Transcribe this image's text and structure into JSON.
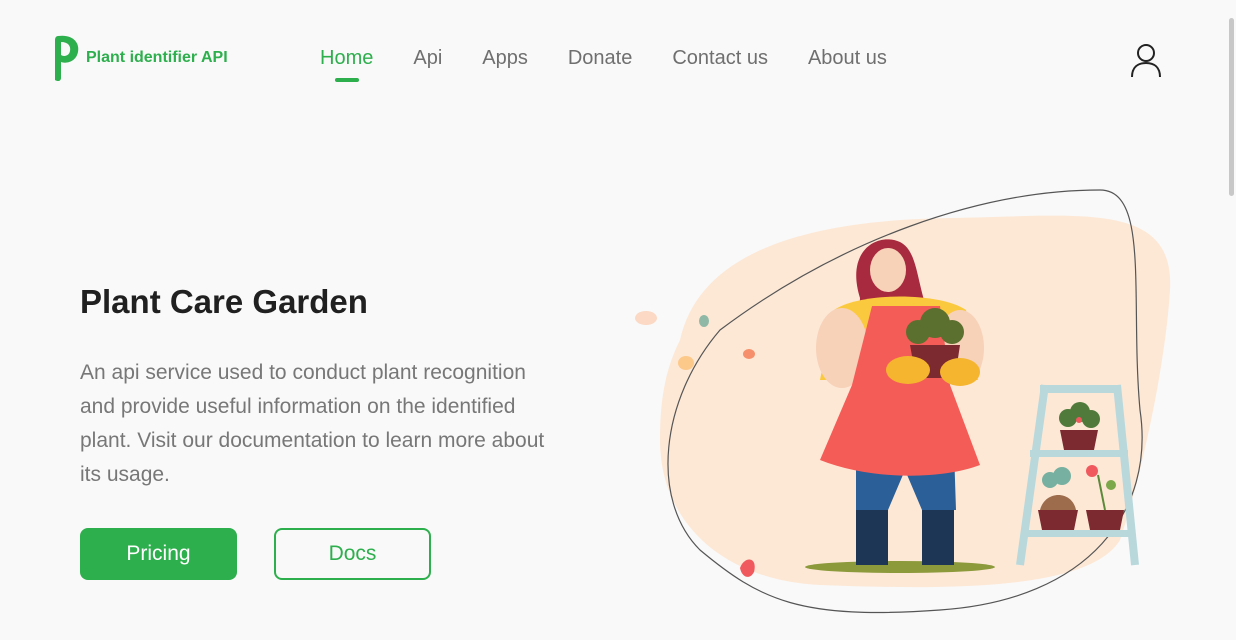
{
  "brand": {
    "name": "Plant identifier API",
    "accent": "#2eaf4d"
  },
  "nav": {
    "items": [
      {
        "label": "Home",
        "active": true
      },
      {
        "label": "Api",
        "active": false
      },
      {
        "label": "Apps",
        "active": false
      },
      {
        "label": "Donate",
        "active": false
      },
      {
        "label": "Contact us",
        "active": false
      },
      {
        "label": "About us",
        "active": false
      }
    ],
    "profile_icon": "user-icon"
  },
  "hero": {
    "title": "Plant Care Garden",
    "description": "An api service used to conduct plant recognition and provide useful information on the identified plant. Visit our documentation to learn more about its usage.",
    "primary_button": "Pricing",
    "secondary_button": "Docs"
  },
  "illustration": {
    "subject": "gardener-with-plants-illustration"
  }
}
